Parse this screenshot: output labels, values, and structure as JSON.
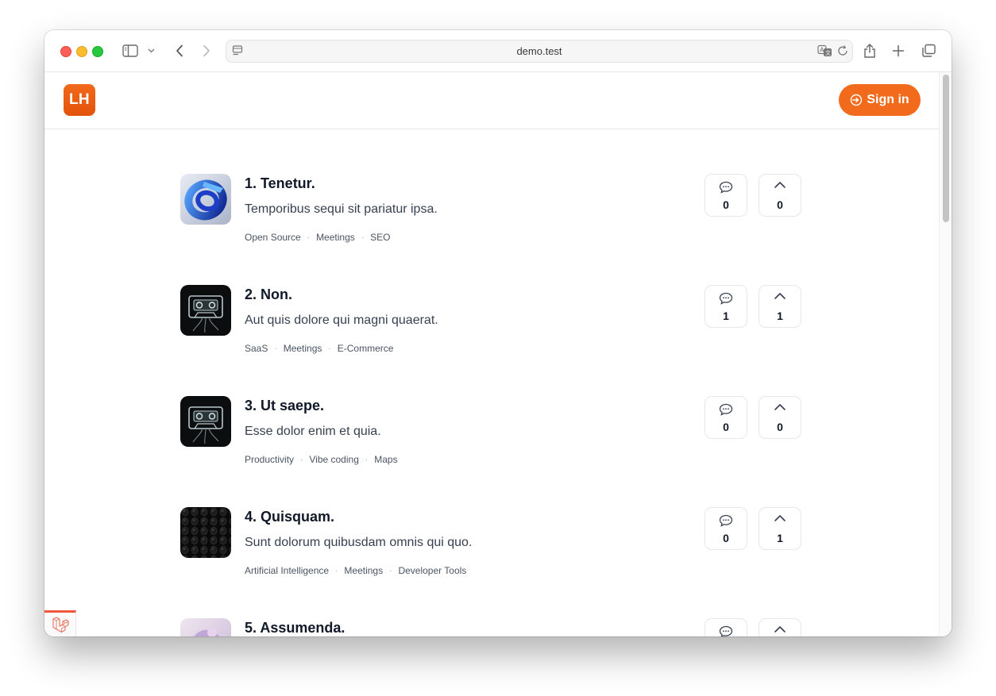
{
  "browser": {
    "url": "demo.test"
  },
  "site": {
    "logo_text": "LH",
    "signin_label": "Sign in",
    "accent_color": "#f26b1d"
  },
  "products": [
    {
      "title": "1. Tenetur.",
      "description": "Temporibus sequi sit pariatur ipsa.",
      "tags": [
        "Open Source",
        "Meetings",
        "SEO"
      ],
      "comments": "0",
      "upvotes": "0",
      "icon": "blue-ring-logo"
    },
    {
      "title": "2. Non.",
      "description": "Aut quis dolore qui magni quaerat.",
      "tags": [
        "SaaS",
        "Meetings",
        "E-Commerce"
      ],
      "comments": "1",
      "upvotes": "1",
      "icon": "cassette-tape-logo"
    },
    {
      "title": "3. Ut saepe.",
      "description": "Esse dolor enim et quia.",
      "tags": [
        "Productivity",
        "Vibe coding",
        "Maps"
      ],
      "comments": "0",
      "upvotes": "0",
      "icon": "cassette-tape-logo"
    },
    {
      "title": "4. Quisquam.",
      "description": "Sunt dolorum quibusdam omnis qui quo.",
      "tags": [
        "Artificial Intelligence",
        "Meetings",
        "Developer Tools"
      ],
      "comments": "0",
      "upvotes": "1",
      "icon": "dark-pattern-logo"
    },
    {
      "title": "5. Assumenda.",
      "description": "",
      "tags": [],
      "comments": "",
      "upvotes": "",
      "icon": "pastel-abstract-logo"
    }
  ]
}
